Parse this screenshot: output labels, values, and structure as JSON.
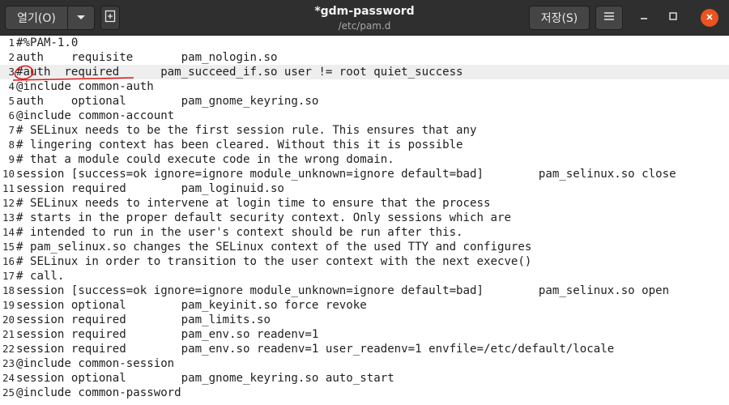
{
  "window": {
    "title": "*gdm-password",
    "subtitle": "/etc/pam.d"
  },
  "toolbar": {
    "open_label": "열기(O)",
    "open_menu_icon": "chevron-down-icon",
    "new_tab_icon": "new-document-icon",
    "save_label": "저장(S)",
    "menu_icon": "hamburger-menu-icon"
  },
  "window_controls": {
    "minimize_icon": "minimize-icon",
    "maximize_icon": "maximize-icon",
    "close_icon": "close-icon"
  },
  "colors": {
    "titlebar": "#2f2f2f",
    "close_button": "#e95420",
    "current_line": "#eeeeee",
    "annotation": "#e01818"
  },
  "editor": {
    "current_line": 3,
    "lines": [
      {
        "num": "1",
        "text": "#%PAM-1.0"
      },
      {
        "num": "2",
        "text": "auth    requisite       pam_nologin.so"
      },
      {
        "num": "3",
        "text": "#auth  required      pam_succeed_if.so user != root quiet_success"
      },
      {
        "num": "4",
        "text": "@include common-auth"
      },
      {
        "num": "5",
        "text": "auth    optional        pam_gnome_keyring.so"
      },
      {
        "num": "6",
        "text": "@include common-account"
      },
      {
        "num": "7",
        "text": "# SELinux needs to be the first session rule. This ensures that any"
      },
      {
        "num": "8",
        "text": "# lingering context has been cleared. Without this it is possible"
      },
      {
        "num": "9",
        "text": "# that a module could execute code in the wrong domain."
      },
      {
        "num": "10",
        "text": "session [success=ok ignore=ignore module_unknown=ignore default=bad]        pam_selinux.so close"
      },
      {
        "num": "11",
        "text": "session required        pam_loginuid.so"
      },
      {
        "num": "12",
        "text": "# SELinux needs to intervene at login time to ensure that the process"
      },
      {
        "num": "13",
        "text": "# starts in the proper default security context. Only sessions which are"
      },
      {
        "num": "14",
        "text": "# intended to run in the user's context should be run after this."
      },
      {
        "num": "15",
        "text": "# pam_selinux.so changes the SELinux context of the used TTY and configures"
      },
      {
        "num": "16",
        "text": "# SELinux in order to transition to the user context with the next execve()"
      },
      {
        "num": "17",
        "text": "# call."
      },
      {
        "num": "18",
        "text": "session [success=ok ignore=ignore module_unknown=ignore default=bad]        pam_selinux.so open"
      },
      {
        "num": "19",
        "text": "session optional        pam_keyinit.so force revoke"
      },
      {
        "num": "20",
        "text": "session required        pam_limits.so"
      },
      {
        "num": "21",
        "text": "session required        pam_env.so readenv=1"
      },
      {
        "num": "22",
        "text": "session required        pam_env.so readenv=1 user_readenv=1 envfile=/etc/default/locale"
      },
      {
        "num": "23",
        "text": "@include common-session"
      },
      {
        "num": "24",
        "text": "session optional        pam_gnome_keyring.so auto_start"
      },
      {
        "num": "25",
        "text": "@include common-password"
      }
    ]
  }
}
